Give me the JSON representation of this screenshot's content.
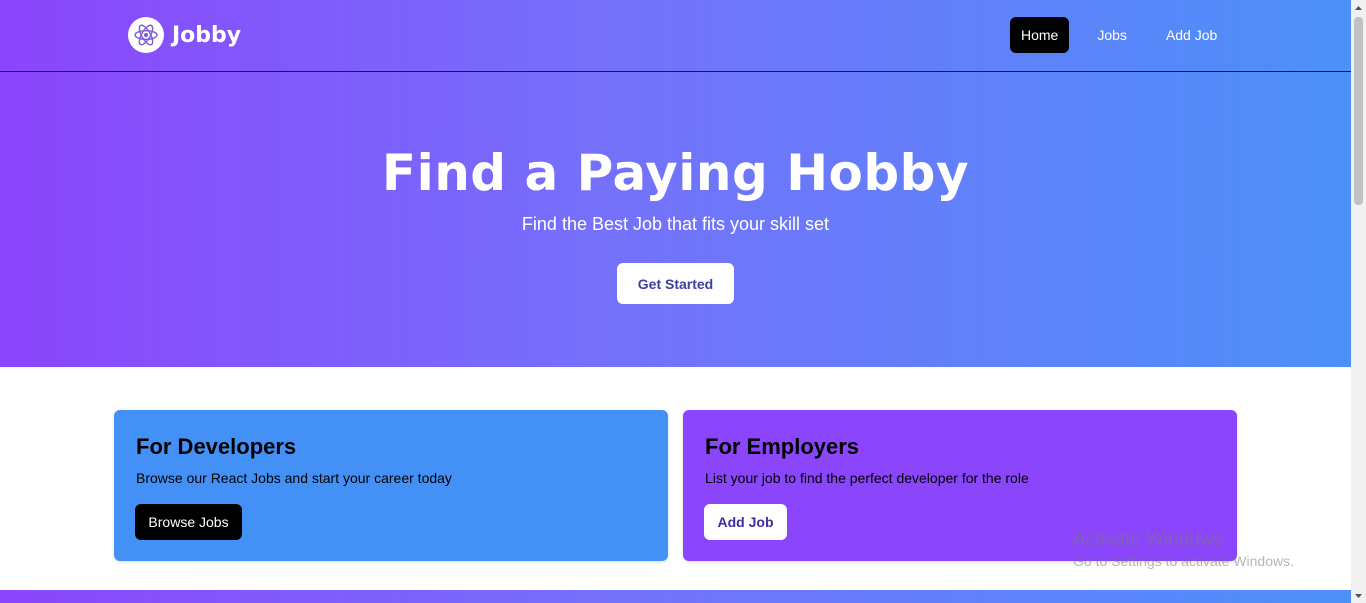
{
  "brand": {
    "name": "Jobby",
    "logo_icon": "react-atom-icon"
  },
  "nav": {
    "links": [
      {
        "label": "Home",
        "active": true
      },
      {
        "label": "Jobs",
        "active": false
      },
      {
        "label": "Add Job",
        "active": false
      }
    ]
  },
  "hero": {
    "title": "Find a Paying Hobby",
    "subtitle": "Find the Best Job that fits your skill set",
    "cta": "Get Started"
  },
  "cards": {
    "developers": {
      "title": "For Developers",
      "description": "Browse our React Jobs and start your career today",
      "button": "Browse Jobs"
    },
    "employers": {
      "title": "For Employers",
      "description": "List your job to find the perfect developer for the role",
      "button": "Add Job"
    }
  },
  "watermark": {
    "title": "Activate Windows",
    "subtitle": "Go to Settings to activate Windows."
  },
  "colors": {
    "gradient_start": "#8b45fb",
    "gradient_end": "#4c90f8",
    "developer_card": "#4391f7",
    "employer_card": "#8b45fb"
  }
}
